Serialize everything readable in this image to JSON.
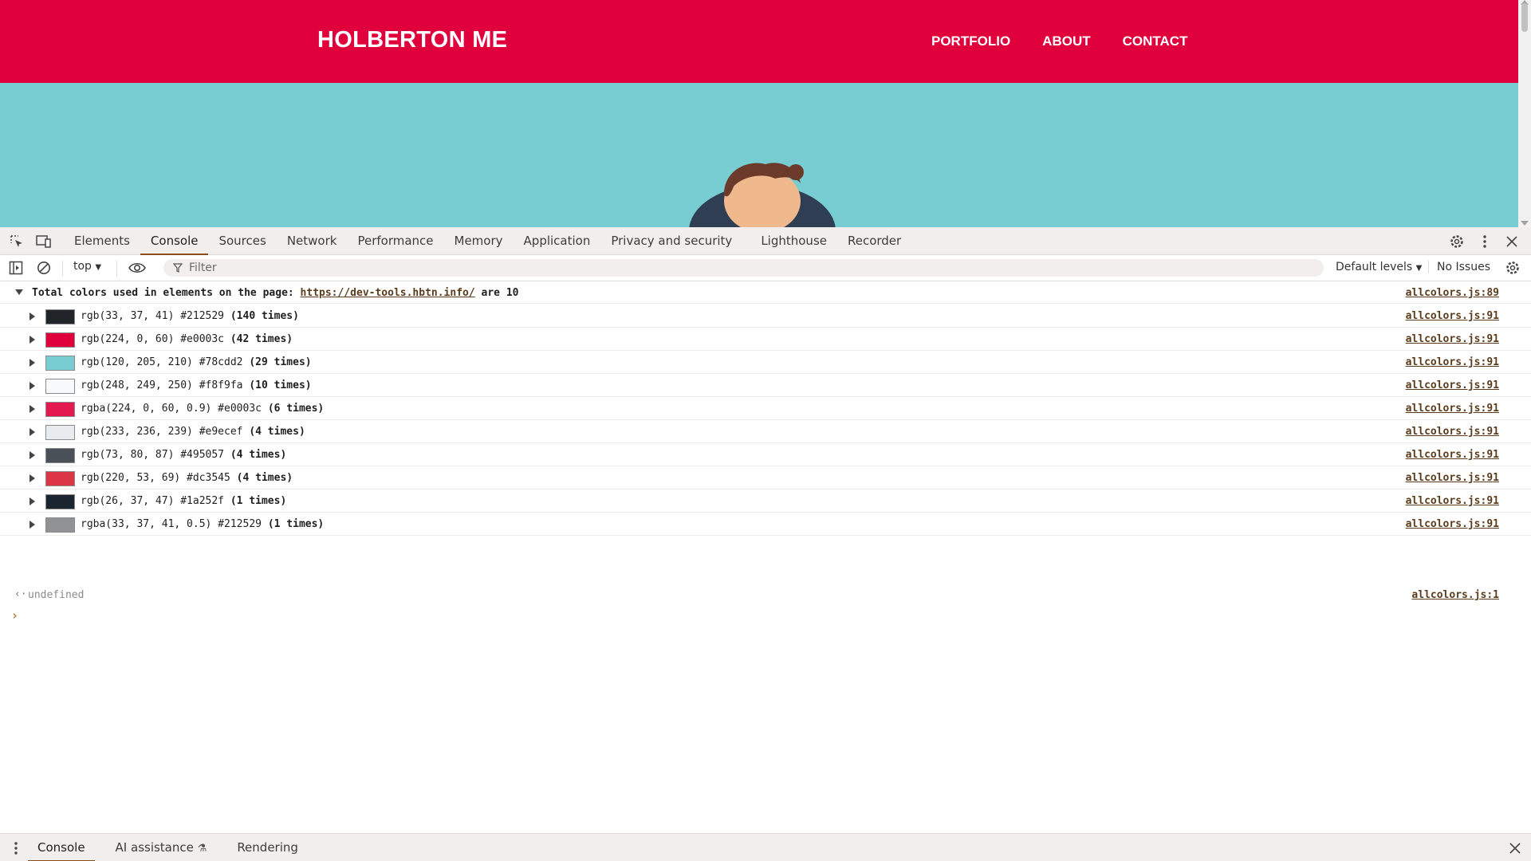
{
  "site": {
    "title": "HOLBERTON ME",
    "nav": [
      "PORTFOLIO",
      "ABOUT",
      "CONTACT"
    ],
    "colors": {
      "header": "#e0003c",
      "hero": "#78cdd2"
    }
  },
  "devtools": {
    "tabs": [
      "Elements",
      "Console",
      "Sources",
      "Network",
      "Performance",
      "Memory",
      "Application",
      "Privacy and security",
      "Lighthouse",
      "Recorder"
    ],
    "active_tab": "Console",
    "toolbar": {
      "context": "top",
      "filter_placeholder": "Filter",
      "levels": "Default levels",
      "issues": "No Issues"
    },
    "console": {
      "header": {
        "prefix": "Total colors used in elements on the page: ",
        "url": "https://dev-tools.hbtn.info/",
        "suffix": " are 10",
        "source": "allcolors.js:89"
      },
      "rows": [
        {
          "value": "rgb(33, 37, 41) #212529 ",
          "count": "(140 times)",
          "swatch": "#212529",
          "source": "allcolors.js:91"
        },
        {
          "value": "rgb(224, 0, 60) #e0003c ",
          "count": "(42 times)",
          "swatch": "#e0003c",
          "source": "allcolors.js:91"
        },
        {
          "value": "rgb(120, 205, 210) #78cdd2 ",
          "count": "(29 times)",
          "swatch": "#78cdd2",
          "source": "allcolors.js:91"
        },
        {
          "value": "rgb(248, 249, 250) #f8f9fa ",
          "count": "(10 times)",
          "swatch": "#f8f9fa",
          "source": "allcolors.js:91"
        },
        {
          "value": "rgba(224, 0, 60, 0.9) #e0003c ",
          "count": "(6 times)",
          "swatch": "rgba(224,0,60,0.9)",
          "source": "allcolors.js:91"
        },
        {
          "value": "rgb(233, 236, 239) #e9ecef ",
          "count": "(4 times)",
          "swatch": "#e9ecef",
          "source": "allcolors.js:91"
        },
        {
          "value": "rgb(73, 80, 87) #495057 ",
          "count": "(4 times)",
          "swatch": "#495057",
          "source": "allcolors.js:91"
        },
        {
          "value": "rgb(220, 53, 69) #dc3545 ",
          "count": "(4 times)",
          "swatch": "#dc3545",
          "source": "allcolors.js:91"
        },
        {
          "value": "rgb(26, 37, 47) #1a252f ",
          "count": "(1 times)",
          "swatch": "#1a252f",
          "source": "allcolors.js:91"
        },
        {
          "value": "rgba(33, 37, 41, 0.5) #212529 ",
          "count": "(1 times)",
          "swatch": "rgba(33,37,41,0.5)",
          "source": "allcolors.js:91"
        }
      ],
      "result": {
        "text": "undefined",
        "source": "allcolors.js:1"
      }
    },
    "drawer": {
      "tabs": [
        "Console",
        "AI assistance",
        "Rendering"
      ],
      "active": "Console"
    }
  }
}
